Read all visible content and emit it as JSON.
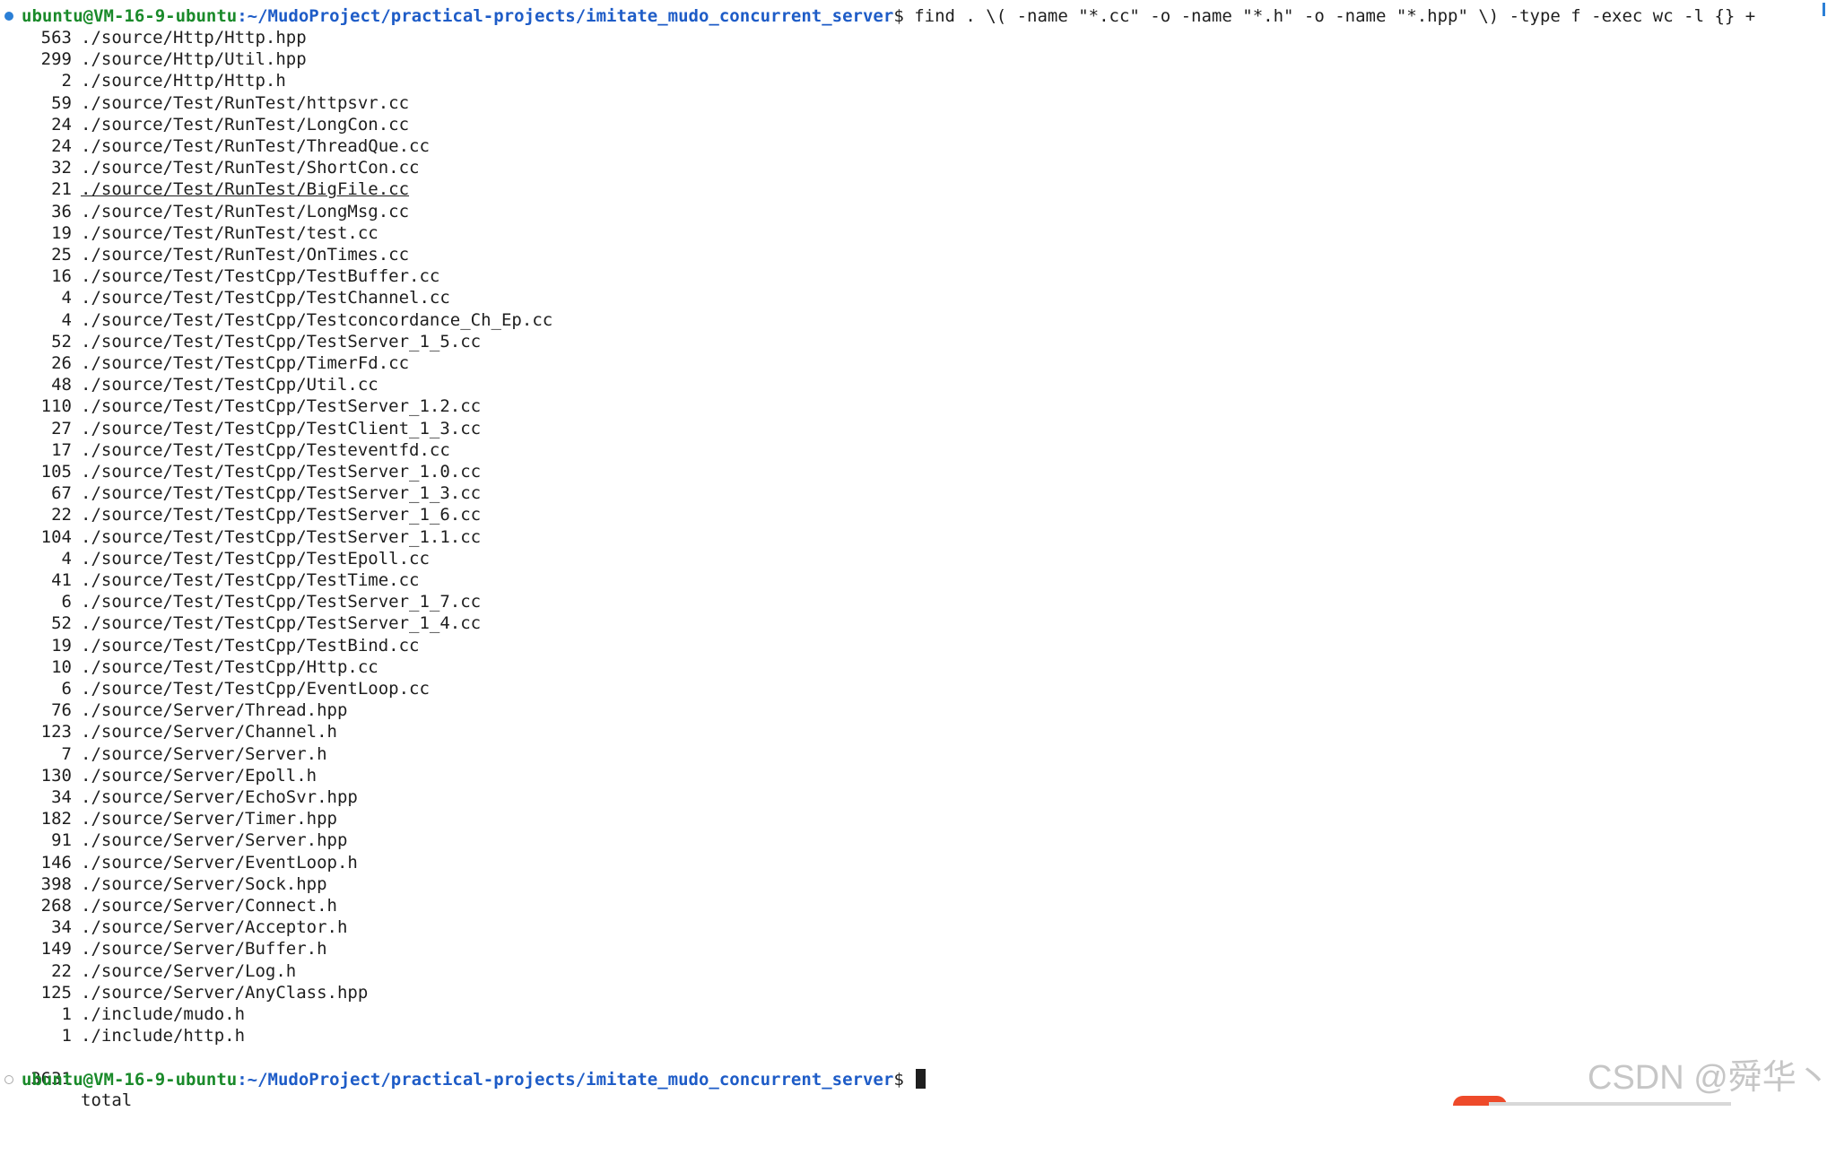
{
  "terminal": {
    "first_prompt": {
      "user_host": "ubuntu@VM-16-9-ubuntu",
      "path": ":~/MudoProject/practical-projects/imitate_mudo_concurrent_server",
      "symbol": "$",
      "command": " find . \\( -name \"*.cc\" -o -name \"*.h\" -o -name \"*.hpp\" \\) -type f -exec wc -l {} +"
    },
    "output": [
      {
        "count": "563",
        "path": "./source/Http/Http.hpp"
      },
      {
        "count": "299",
        "path": "./source/Http/Util.hpp"
      },
      {
        "count": "2",
        "path": "./source/Http/Http.h"
      },
      {
        "count": "59",
        "path": "./source/Test/RunTest/httpsvr.cc"
      },
      {
        "count": "24",
        "path": "./source/Test/RunTest/LongCon.cc"
      },
      {
        "count": "24",
        "path": "./source/Test/RunTest/ThreadQue.cc"
      },
      {
        "count": "32",
        "path": "./source/Test/RunTest/ShortCon.cc"
      },
      {
        "count": "21",
        "path": "./source/Test/RunTest/BigFile.cc"
      },
      {
        "count": "36",
        "path": "./source/Test/RunTest/LongMsg.cc"
      },
      {
        "count": "19",
        "path": "./source/Test/RunTest/test.cc"
      },
      {
        "count": "25",
        "path": "./source/Test/RunTest/OnTimes.cc"
      },
      {
        "count": "16",
        "path": "./source/Test/TestCpp/TestBuffer.cc"
      },
      {
        "count": "4",
        "path": "./source/Test/TestCpp/TestChannel.cc"
      },
      {
        "count": "4",
        "path": "./source/Test/TestCpp/Testconcordance_Ch_Ep.cc"
      },
      {
        "count": "52",
        "path": "./source/Test/TestCpp/TestServer_1_5.cc"
      },
      {
        "count": "26",
        "path": "./source/Test/TestCpp/TimerFd.cc"
      },
      {
        "count": "48",
        "path": "./source/Test/TestCpp/Util.cc"
      },
      {
        "count": "110",
        "path": "./source/Test/TestCpp/TestServer_1.2.cc"
      },
      {
        "count": "27",
        "path": "./source/Test/TestCpp/TestClient_1_3.cc"
      },
      {
        "count": "17",
        "path": "./source/Test/TestCpp/Testeventfd.cc"
      },
      {
        "count": "105",
        "path": "./source/Test/TestCpp/TestServer_1.0.cc"
      },
      {
        "count": "67",
        "path": "./source/Test/TestCpp/TestServer_1_3.cc"
      },
      {
        "count": "22",
        "path": "./source/Test/TestCpp/TestServer_1_6.cc"
      },
      {
        "count": "104",
        "path": "./source/Test/TestCpp/TestServer_1.1.cc"
      },
      {
        "count": "4",
        "path": "./source/Test/TestCpp/TestEpoll.cc"
      },
      {
        "count": "41",
        "path": "./source/Test/TestCpp/TestTime.cc"
      },
      {
        "count": "6",
        "path": "./source/Test/TestCpp/TestServer_1_7.cc"
      },
      {
        "count": "52",
        "path": "./source/Test/TestCpp/TestServer_1_4.cc"
      },
      {
        "count": "19",
        "path": "./source/Test/TestCpp/TestBind.cc"
      },
      {
        "count": "10",
        "path": "./source/Test/TestCpp/Http.cc"
      },
      {
        "count": "6",
        "path": "./source/Test/TestCpp/EventLoop.cc"
      },
      {
        "count": "76",
        "path": "./source/Server/Thread.hpp"
      },
      {
        "count": "123",
        "path": "./source/Server/Channel.h"
      },
      {
        "count": "7",
        "path": "./source/Server/Server.h"
      },
      {
        "count": "130",
        "path": "./source/Server/Epoll.h"
      },
      {
        "count": "34",
        "path": "./source/Server/EchoSvr.hpp"
      },
      {
        "count": "182",
        "path": "./source/Server/Timer.hpp"
      },
      {
        "count": "91",
        "path": "./source/Server/Server.hpp"
      },
      {
        "count": "146",
        "path": "./source/Server/EventLoop.h"
      },
      {
        "count": "398",
        "path": "./source/Server/Sock.hpp"
      },
      {
        "count": "268",
        "path": "./source/Server/Connect.h"
      },
      {
        "count": "34",
        "path": "./source/Server/Acceptor.h"
      },
      {
        "count": "149",
        "path": "./source/Server/Buffer.h"
      },
      {
        "count": "22",
        "path": "./source/Server/Log.h"
      },
      {
        "count": "125",
        "path": "./source/Server/AnyClass.hpp"
      },
      {
        "count": "1",
        "path": "./include/mudo.h"
      },
      {
        "count": "1",
        "path": "./include/http.h"
      }
    ],
    "total": {
      "count": "3631",
      "label": "total"
    },
    "second_prompt": {
      "user_host": "ubuntu@VM-16-9-ubuntu",
      "path": ":~/MudoProject/practical-projects/imitate_mudo_concurrent_server",
      "symbol": "$"
    }
  },
  "watermark": "CSDN @舜华丶",
  "colors": {
    "user_host": "#1a8a2a",
    "path": "#1e5cc7",
    "text": "#1e1e1e",
    "status_dot": "#2b7fd6"
  }
}
